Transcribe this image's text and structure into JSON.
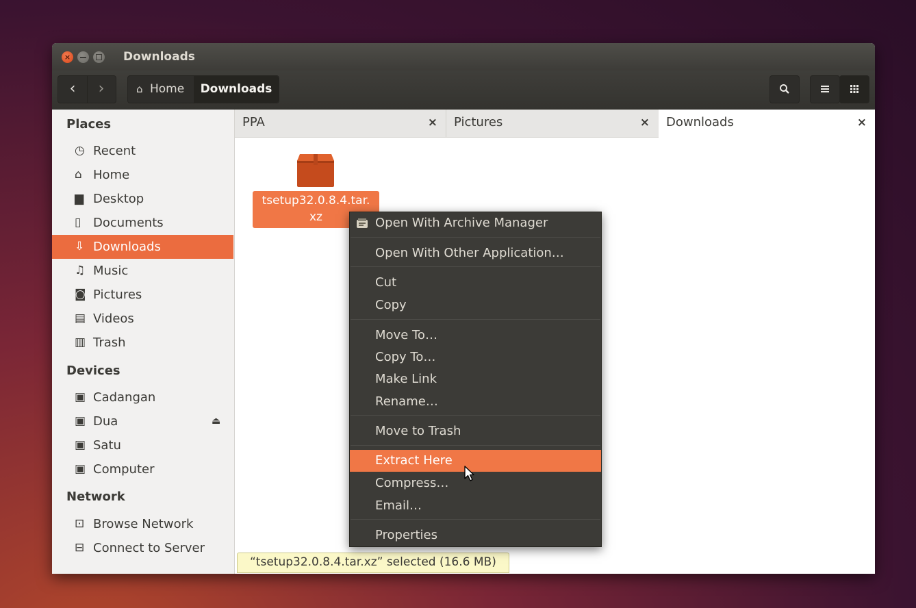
{
  "window": {
    "title": "Downloads"
  },
  "toolbar": {
    "back_glyph": "‹",
    "forward_glyph": "›",
    "breadcrumb_home": "Home",
    "breadcrumb_current": "Downloads",
    "search_glyph": "🔍",
    "list_glyph": "≡",
    "grid_glyph": "⠿"
  },
  "sidebar": {
    "places_header": "Places",
    "places": [
      {
        "label": "Recent",
        "icon": "clock-icon"
      },
      {
        "label": "Home",
        "icon": "home-icon"
      },
      {
        "label": "Desktop",
        "icon": "folder-icon"
      },
      {
        "label": "Documents",
        "icon": "document-icon"
      },
      {
        "label": "Downloads",
        "icon": "download-icon",
        "selected": true
      },
      {
        "label": "Music",
        "icon": "music-icon"
      },
      {
        "label": "Pictures",
        "icon": "camera-icon"
      },
      {
        "label": "Videos",
        "icon": "film-icon"
      },
      {
        "label": "Trash",
        "icon": "trash-icon"
      }
    ],
    "devices_header": "Devices",
    "devices": [
      {
        "label": "Cadangan",
        "icon": "drive-icon"
      },
      {
        "label": "Dua",
        "icon": "drive-icon",
        "eject": true
      },
      {
        "label": "Satu",
        "icon": "drive-icon"
      },
      {
        "label": "Computer",
        "icon": "drive-icon"
      }
    ],
    "network_header": "Network",
    "network": [
      {
        "label": "Browse Network",
        "icon": "network-icon"
      },
      {
        "label": "Connect to Server",
        "icon": "server-icon"
      }
    ]
  },
  "tabs": [
    {
      "label": "PPA",
      "close": "×"
    },
    {
      "label": "Pictures",
      "close": "×"
    },
    {
      "label": "Downloads",
      "close": "×",
      "active": true
    }
  ],
  "file": {
    "name_line1": "tsetup32.0.8.4.tar.",
    "name_line2": "xz",
    "icon": "archive-icon"
  },
  "status": {
    "text": "“tsetup32.0.8.4.tar.xz” selected  (16.6 MB)"
  },
  "context_menu": {
    "items": [
      {
        "label": "Open With Archive Manager",
        "icon": "archive-manager-icon"
      },
      {
        "label": "Open With Other Application…"
      },
      {
        "label": "Cut"
      },
      {
        "label": "Copy"
      },
      {
        "label": "Move To…"
      },
      {
        "label": "Copy To…"
      },
      {
        "label": "Make Link"
      },
      {
        "label": "Rename…"
      },
      {
        "label": "Move to Trash"
      },
      {
        "label": "Extract Here",
        "highlighted": true
      },
      {
        "label": "Compress…"
      },
      {
        "label": "Email…"
      },
      {
        "label": "Properties"
      }
    ]
  },
  "colors": {
    "accent": "#f07746",
    "menu_bg": "#3c3b37",
    "titlebar": "#3d3c38"
  }
}
